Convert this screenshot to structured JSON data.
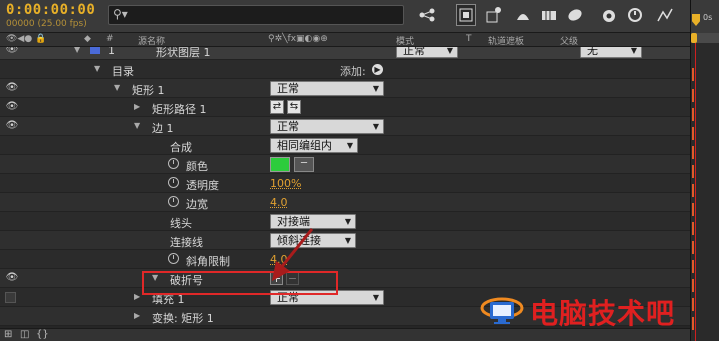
{
  "toolbar": {
    "timecode": "0:00:00:00",
    "fps": "00000 (25.00 fps)",
    "search_placeholder": "",
    "search_glyph": "⚲▾"
  },
  "ruler": {
    "label": "0s"
  },
  "columns": {
    "number": "#",
    "source_name": "源名称",
    "switches": "⚲✲╲fx▣◐◉⊕",
    "mode": "模式",
    "t": "T",
    "trkmat": "轨道遮板",
    "parent": "父级"
  },
  "layer": {
    "index": "1",
    "name": "形状图层 1",
    "mode": "正常",
    "parent": "无"
  },
  "rows": {
    "contents": "目录",
    "add_label": "添加:",
    "rect": "矩形 1",
    "rect_mode": "正常",
    "rect_path": "矩形路径 1",
    "stroke": "边 1",
    "stroke_mode": "正常",
    "composite": "合成",
    "composite_value": "相同编组内",
    "color": "颜色",
    "opacity": "透明度",
    "opacity_value": "100%",
    "stroke_width": "边宽",
    "stroke_width_value": "4.0",
    "line_cap": "线头",
    "line_cap_value": "对接端",
    "line_join": "连接线",
    "line_join_value": "倾斜连接",
    "miter_limit": "斜角限制",
    "miter_limit_value": "4.0",
    "dashes": "破折号",
    "fill": "填充 1",
    "fill_mode": "正常",
    "transform": "变换: 矩形 1"
  },
  "watermark": {
    "text": "电脑技术吧"
  },
  "colors": {
    "timecode": "#e8b028",
    "swatch": "#2ccc3c",
    "highlight": "#e02828",
    "value": "#e0a030"
  }
}
